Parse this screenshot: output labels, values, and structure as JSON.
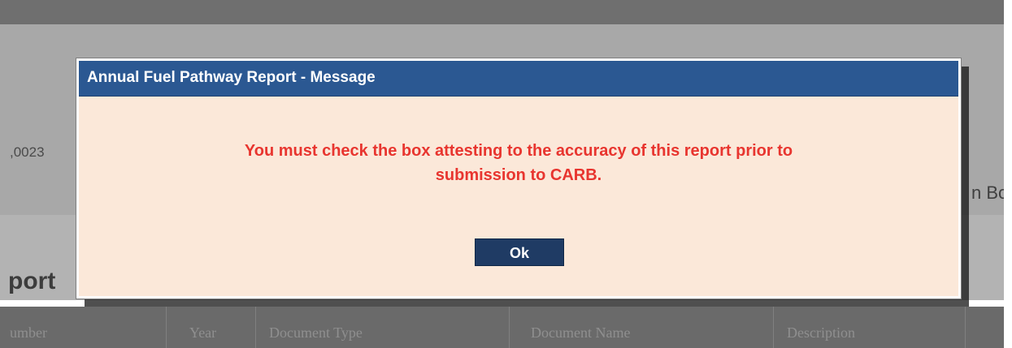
{
  "background": {
    "number_fragment": ",0023",
    "right_fragment": "n Bo",
    "heading_fragment": "port",
    "table_headers": [
      "umber",
      "Year",
      "Document Type",
      "Document Name",
      "Description"
    ]
  },
  "dialog": {
    "title": "Annual Fuel Pathway Report - Message",
    "message_line1": "You must check the box attesting to the accuracy of this report prior to",
    "message_line2": "submission to CARB.",
    "ok_label": "Ok"
  },
  "colors": {
    "title_bar": "#2b5892",
    "dialog_body": "#fbe8d9",
    "message_text": "#e8352f",
    "ok_button": "#1f3b64",
    "overlay_gray": "#a8a8a8"
  }
}
